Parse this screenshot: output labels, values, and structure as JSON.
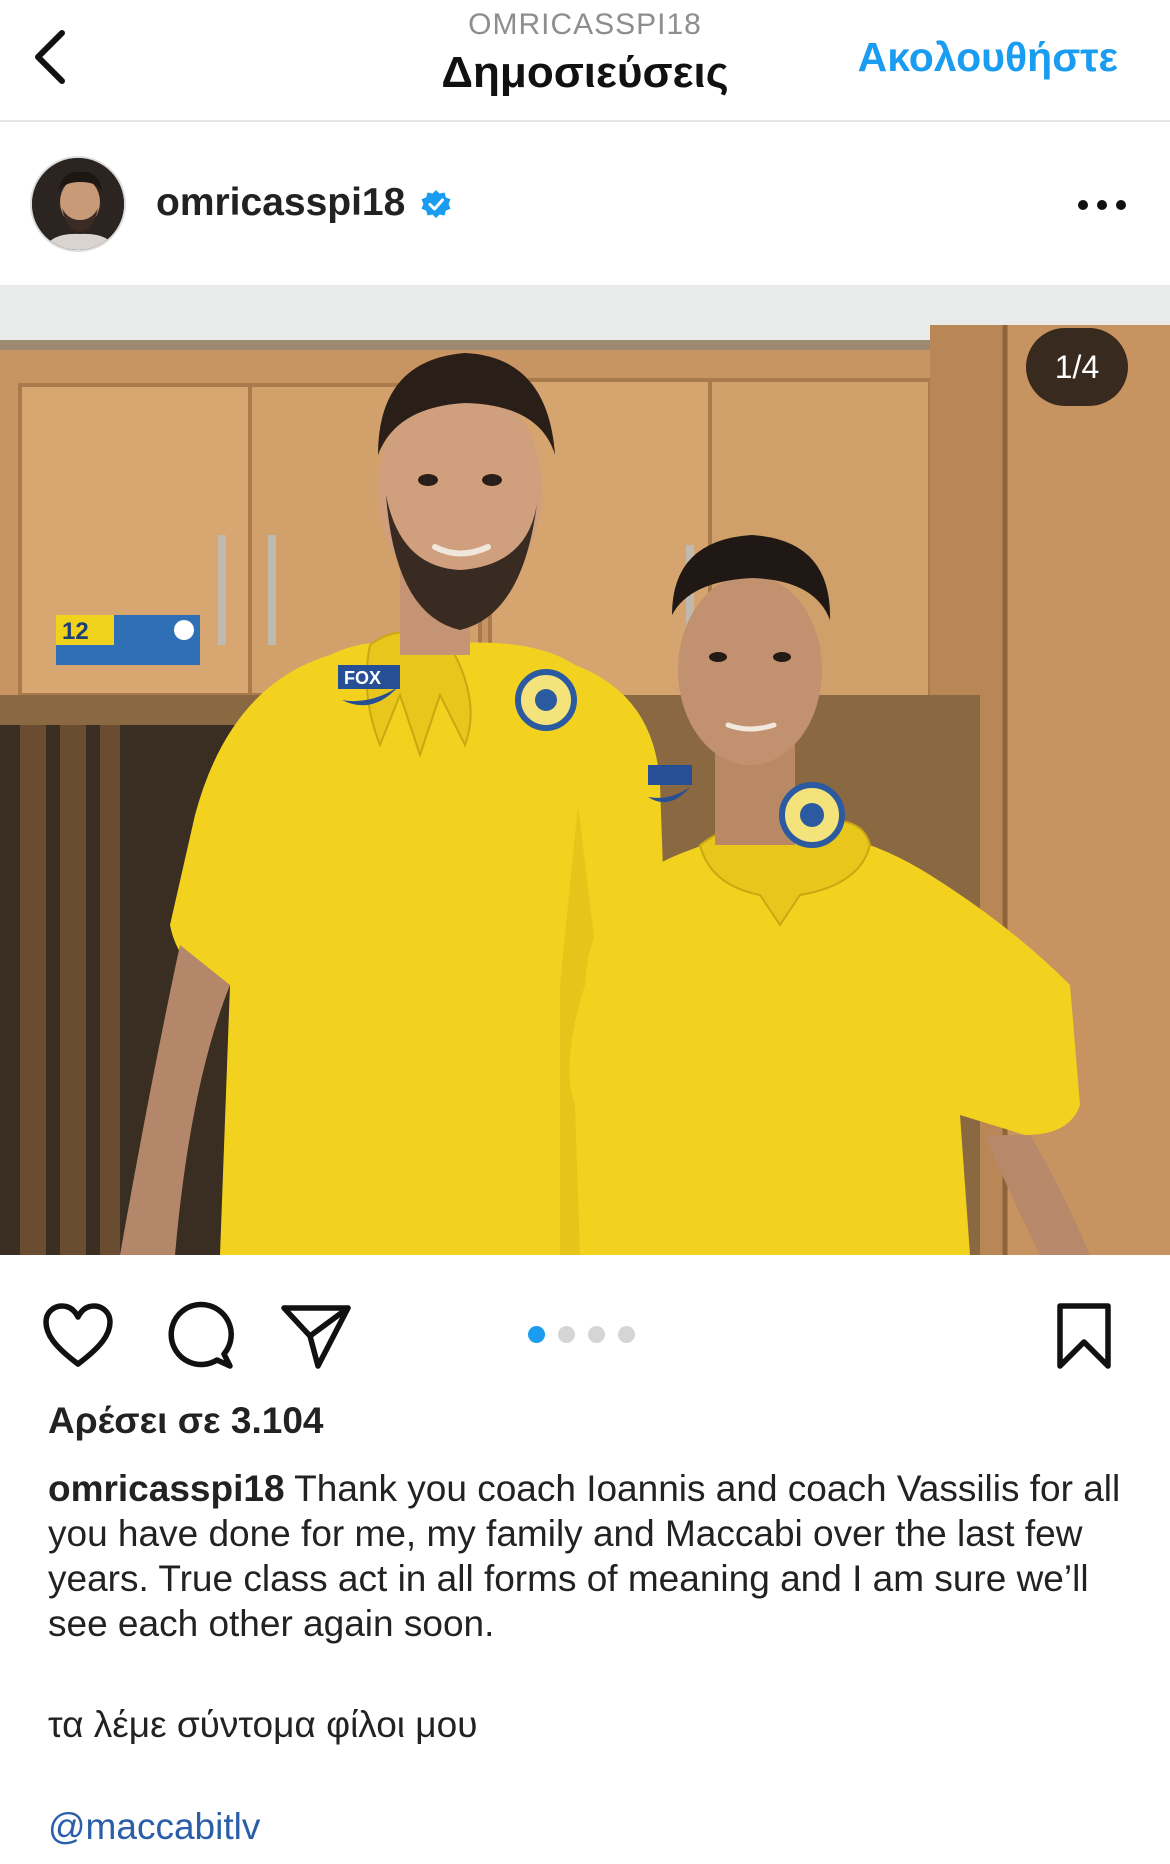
{
  "nav": {
    "account_handle": "OMRICASSPI18",
    "title": "Δημοσιεύσεις",
    "follow_label": "Ακολουθήστε"
  },
  "post": {
    "username": "omricasspi18",
    "verified": true,
    "media_counter": "1/4",
    "carousel": {
      "total": 4,
      "active_index": 0
    },
    "likes_text": "Αρέσει σε 3.104",
    "caption_user": "omricasspi18",
    "caption_text": " Thank you coach Ioannis and coach Vassilis for all you have done for me, my family and Maccabi over the last few years. True class act in all forms of meaning and I am sure we’ll see each other again soon.",
    "caption_greek": "τα λέμε σύντομα φίλοι μου",
    "mention": "@maccabitlv"
  },
  "photo": {
    "locker_tag_number": "12",
    "shirt_brand_text": "FOX"
  },
  "icons": {
    "back": "chevron-left-icon",
    "verified": "verified-badge-icon",
    "more": "more-horizontal-icon",
    "like": "heart-icon",
    "comment": "comment-bubble-icon",
    "share": "paper-plane-icon",
    "save": "bookmark-icon"
  },
  "colors": {
    "accent": "#1a9cf0",
    "mention": "#2b5ea8",
    "muted": "#8e8e8e",
    "shirt_yellow": "#f2d21e"
  }
}
